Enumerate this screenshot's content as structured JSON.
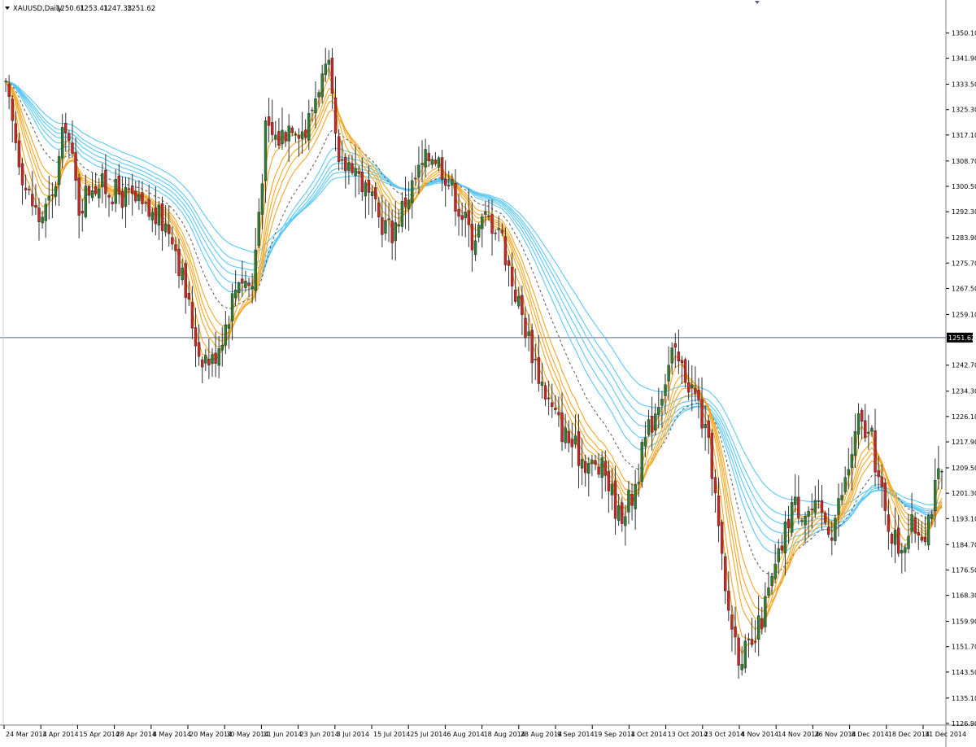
{
  "header": {
    "symbol": "XAUUSD,Daily",
    "open": "1250.61",
    "high": "1253.41",
    "low": "1247.33",
    "close": "1251.62"
  },
  "current_price_label": "1251.62",
  "colors": {
    "bull": "#2e7d32",
    "bear": "#c62828",
    "short_ema": "#f5a623",
    "long_ema": "#5bc8f5",
    "separator": "#808080",
    "price_line": "#5a6478"
  },
  "chart_data": {
    "type": "candlestick",
    "ylim": [
      1126.9,
      1356.0
    ],
    "y_ticks": [
      "1350.10",
      "1341.90",
      "1333.50",
      "1325.30",
      "1317.10",
      "1308.70",
      "1300.50",
      "1292.30",
      "1283.90",
      "1275.70",
      "1267.50",
      "1259.10",
      "1242.70",
      "1234.30",
      "1226.10",
      "1217.90",
      "1209.50",
      "1201.30",
      "1193.10",
      "1184.70",
      "1176.50",
      "1168.30",
      "1159.90",
      "1151.70",
      "1143.50",
      "1135.10",
      "1126.90"
    ],
    "x_labels": [
      "24 Mar 2014",
      "3 Apr 2014",
      "15 Apr 2014",
      "28 Apr 2014",
      "8 May 2014",
      "20 May 2014",
      "30 May 2014",
      "11 Jun 2014",
      "23 Jun 2014",
      "3 Jul 2014",
      "15 Jul 2014",
      "25 Jul 2014",
      "6 Aug 2014",
      "18 Aug 2014",
      "28 Aug 2014",
      "9 Sep 2014",
      "19 Sep 2014",
      "1 Oct 2014",
      "13 Oct 2014",
      "23 Oct 2014",
      "4 Nov 2014",
      "14 Nov 2014",
      "26 Nov 2014",
      "8 Dec 2014",
      "18 Dec 2014",
      "31 Dec 2014"
    ],
    "guppy": {
      "short_count": 6,
      "long_count": 6,
      "mid_dashed": true
    },
    "close_anchors": [
      [
        0,
        1331
      ],
      [
        6,
        1300
      ],
      [
        10,
        1290
      ],
      [
        14,
        1296
      ],
      [
        18,
        1322
      ],
      [
        22,
        1294
      ],
      [
        26,
        1302
      ],
      [
        30,
        1300
      ],
      [
        34,
        1298
      ],
      [
        38,
        1296
      ],
      [
        42,
        1292
      ],
      [
        46,
        1290
      ],
      [
        50,
        1286
      ],
      [
        54,
        1266
      ],
      [
        58,
        1247
      ],
      [
        62,
        1244
      ],
      [
        66,
        1256
      ],
      [
        70,
        1272
      ],
      [
        74,
        1268
      ],
      [
        78,
        1318
      ],
      [
        82,
        1316
      ],
      [
        86,
        1322
      ],
      [
        90,
        1318
      ],
      [
        94,
        1334
      ],
      [
        97,
        1337
      ],
      [
        100,
        1305
      ],
      [
        104,
        1309
      ],
      [
        108,
        1299
      ],
      [
        112,
        1290
      ],
      [
        116,
        1286
      ],
      [
        120,
        1296
      ],
      [
        124,
        1305
      ],
      [
        128,
        1312
      ],
      [
        132,
        1305
      ],
      [
        136,
        1294
      ],
      [
        140,
        1284
      ],
      [
        144,
        1290
      ],
      [
        148,
        1288
      ],
      [
        152,
        1270
      ],
      [
        156,
        1255
      ],
      [
        160,
        1240
      ],
      [
        164,
        1228
      ],
      [
        168,
        1220
      ],
      [
        172,
        1214
      ],
      [
        176,
        1210
      ],
      [
        180,
        1208
      ],
      [
        184,
        1194
      ],
      [
        188,
        1200
      ],
      [
        192,
        1218
      ],
      [
        196,
        1232
      ],
      [
        200,
        1246
      ],
      [
        204,
        1240
      ],
      [
        208,
        1230
      ],
      [
        212,
        1210
      ],
      [
        216,
        1168
      ],
      [
        220,
        1150
      ],
      [
        224,
        1150
      ],
      [
        228,
        1165
      ],
      [
        232,
        1180
      ],
      [
        236,
        1198
      ],
      [
        240,
        1196
      ],
      [
        244,
        1195
      ],
      [
        248,
        1190
      ],
      [
        252,
        1205
      ],
      [
        256,
        1224
      ],
      [
        260,
        1218
      ],
      [
        264,
        1194
      ],
      [
        268,
        1184
      ],
      [
        272,
        1190
      ],
      [
        276,
        1190
      ],
      [
        280,
        1206
      ]
    ],
    "current_price": 1251.62
  }
}
